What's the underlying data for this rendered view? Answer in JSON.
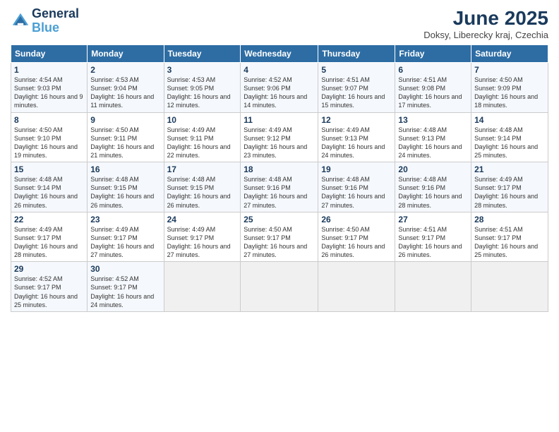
{
  "header": {
    "logo_line1": "General",
    "logo_line2": "Blue",
    "month_title": "June 2025",
    "subtitle": "Doksy, Liberecky kraj, Czechia"
  },
  "weekdays": [
    "Sunday",
    "Monday",
    "Tuesday",
    "Wednesday",
    "Thursday",
    "Friday",
    "Saturday"
  ],
  "weeks": [
    [
      {
        "day": "1",
        "sunrise": "4:54 AM",
        "sunset": "9:03 PM",
        "daylight": "16 hours and 9 minutes."
      },
      {
        "day": "2",
        "sunrise": "4:53 AM",
        "sunset": "9:04 PM",
        "daylight": "16 hours and 11 minutes."
      },
      {
        "day": "3",
        "sunrise": "4:53 AM",
        "sunset": "9:05 PM",
        "daylight": "16 hours and 12 minutes."
      },
      {
        "day": "4",
        "sunrise": "4:52 AM",
        "sunset": "9:06 PM",
        "daylight": "16 hours and 14 minutes."
      },
      {
        "day": "5",
        "sunrise": "4:51 AM",
        "sunset": "9:07 PM",
        "daylight": "16 hours and 15 minutes."
      },
      {
        "day": "6",
        "sunrise": "4:51 AM",
        "sunset": "9:08 PM",
        "daylight": "16 hours and 17 minutes."
      },
      {
        "day": "7",
        "sunrise": "4:50 AM",
        "sunset": "9:09 PM",
        "daylight": "16 hours and 18 minutes."
      }
    ],
    [
      {
        "day": "8",
        "sunrise": "4:50 AM",
        "sunset": "9:10 PM",
        "daylight": "16 hours and 19 minutes."
      },
      {
        "day": "9",
        "sunrise": "4:50 AM",
        "sunset": "9:11 PM",
        "daylight": "16 hours and 21 minutes."
      },
      {
        "day": "10",
        "sunrise": "4:49 AM",
        "sunset": "9:11 PM",
        "daylight": "16 hours and 22 minutes."
      },
      {
        "day": "11",
        "sunrise": "4:49 AM",
        "sunset": "9:12 PM",
        "daylight": "16 hours and 23 minutes."
      },
      {
        "day": "12",
        "sunrise": "4:49 AM",
        "sunset": "9:13 PM",
        "daylight": "16 hours and 24 minutes."
      },
      {
        "day": "13",
        "sunrise": "4:48 AM",
        "sunset": "9:13 PM",
        "daylight": "16 hours and 24 minutes."
      },
      {
        "day": "14",
        "sunrise": "4:48 AM",
        "sunset": "9:14 PM",
        "daylight": "16 hours and 25 minutes."
      }
    ],
    [
      {
        "day": "15",
        "sunrise": "4:48 AM",
        "sunset": "9:14 PM",
        "daylight": "16 hours and 26 minutes."
      },
      {
        "day": "16",
        "sunrise": "4:48 AM",
        "sunset": "9:15 PM",
        "daylight": "16 hours and 26 minutes."
      },
      {
        "day": "17",
        "sunrise": "4:48 AM",
        "sunset": "9:15 PM",
        "daylight": "16 hours and 26 minutes."
      },
      {
        "day": "18",
        "sunrise": "4:48 AM",
        "sunset": "9:16 PM",
        "daylight": "16 hours and 27 minutes."
      },
      {
        "day": "19",
        "sunrise": "4:48 AM",
        "sunset": "9:16 PM",
        "daylight": "16 hours and 27 minutes."
      },
      {
        "day": "20",
        "sunrise": "4:48 AM",
        "sunset": "9:16 PM",
        "daylight": "16 hours and 28 minutes."
      },
      {
        "day": "21",
        "sunrise": "4:49 AM",
        "sunset": "9:17 PM",
        "daylight": "16 hours and 28 minutes."
      }
    ],
    [
      {
        "day": "22",
        "sunrise": "4:49 AM",
        "sunset": "9:17 PM",
        "daylight": "16 hours and 28 minutes."
      },
      {
        "day": "23",
        "sunrise": "4:49 AM",
        "sunset": "9:17 PM",
        "daylight": "16 hours and 27 minutes."
      },
      {
        "day": "24",
        "sunrise": "4:49 AM",
        "sunset": "9:17 PM",
        "daylight": "16 hours and 27 minutes."
      },
      {
        "day": "25",
        "sunrise": "4:50 AM",
        "sunset": "9:17 PM",
        "daylight": "16 hours and 27 minutes."
      },
      {
        "day": "26",
        "sunrise": "4:50 AM",
        "sunset": "9:17 PM",
        "daylight": "16 hours and 26 minutes."
      },
      {
        "day": "27",
        "sunrise": "4:51 AM",
        "sunset": "9:17 PM",
        "daylight": "16 hours and 26 minutes."
      },
      {
        "day": "28",
        "sunrise": "4:51 AM",
        "sunset": "9:17 PM",
        "daylight": "16 hours and 25 minutes."
      }
    ],
    [
      {
        "day": "29",
        "sunrise": "4:52 AM",
        "sunset": "9:17 PM",
        "daylight": "16 hours and 25 minutes."
      },
      {
        "day": "30",
        "sunrise": "4:52 AM",
        "sunset": "9:17 PM",
        "daylight": "16 hours and 24 minutes."
      },
      null,
      null,
      null,
      null,
      null
    ]
  ]
}
